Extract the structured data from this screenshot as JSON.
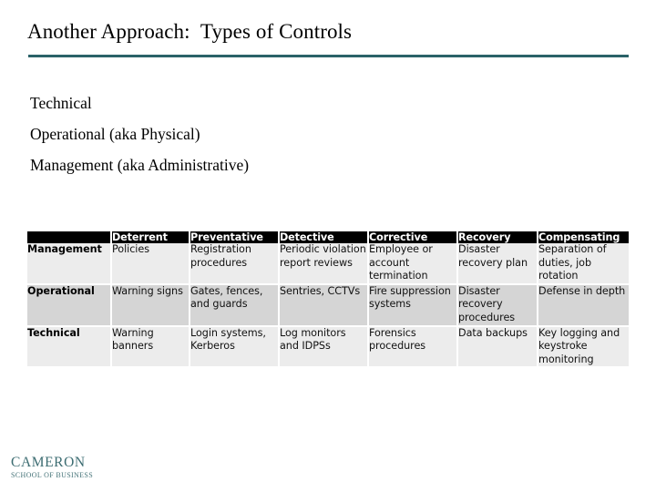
{
  "slide": {
    "title": "Another Approach:  Types of Controls",
    "rule_color": "#2a6268"
  },
  "body": {
    "lines": [
      "Technical",
      "Operational (aka Physical)",
      "Management (aka Administrative)"
    ]
  },
  "matrix": {
    "corner_label": "",
    "columns": [
      "Deterrent",
      "Preventative",
      "Detective",
      "Corrective",
      "Recovery",
      "Compensating"
    ],
    "rows": [
      {
        "label": "Management",
        "cells": [
          "Policies",
          "Registration procedures",
          "Periodic violation report reviews",
          "Employee or account termination",
          "Disaster recovery plan",
          "Separation of duties, job rotation"
        ]
      },
      {
        "label": "Operational",
        "cells": [
          "Warning signs",
          "Gates, fences, and guards",
          "Sentries, CCTVs",
          "Fire suppression systems",
          "Disaster recovery procedures",
          "Defense in depth"
        ]
      },
      {
        "label": "Technical",
        "cells": [
          "Warning banners",
          "Login systems, Kerberos",
          "Log monitors and IDPSs",
          "Forensics procedures",
          "Data backups",
          "Key logging and keystroke monitoring"
        ]
      }
    ],
    "header_bg": "#000000",
    "header_fg": "#ffffff",
    "band_light": "#ececec",
    "band_dark": "#d5d5d5"
  },
  "footer": {
    "logo_name": "CAMERON",
    "logo_tagline": "SCHOOL OF BUSINESS",
    "logo_color": "#2c6066"
  }
}
